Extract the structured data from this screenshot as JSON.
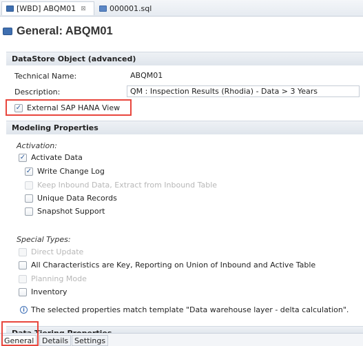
{
  "tabs": [
    {
      "label": "[WBD] ABQM01",
      "close": "⊠",
      "icon": "datastore-icon"
    },
    {
      "label": "000001.sql",
      "icon": "sql-file-icon"
    }
  ],
  "header": {
    "title": "General: ABQM01",
    "icon": "datastore-icon"
  },
  "dso_section": {
    "title": "DataStore Object (advanced)",
    "technical_name_label": "Technical Name:",
    "technical_name_value": "ABQM01",
    "description_label": "Description:",
    "description_value": "QM : Inspection Results (Rhodia) - Data > 3 Years",
    "external_view_label": "External SAP HANA View",
    "external_view_checked": true
  },
  "modeling": {
    "title": "Modeling Properties",
    "activation_label": "Activation:",
    "activate_data": {
      "label": "Activate Data",
      "checked": true
    },
    "write_change_log": {
      "label": "Write Change Log",
      "checked": true
    },
    "keep_inbound": {
      "label": "Keep Inbound Data, Extract from Inbound Table",
      "checked": false,
      "disabled": true
    },
    "unique_records": {
      "label": "Unique Data Records",
      "checked": false
    },
    "snapshot_support": {
      "label": "Snapshot Support",
      "checked": false
    },
    "special_types_label": "Special Types:",
    "direct_update": {
      "label": "Direct Update",
      "checked": false,
      "disabled": true
    },
    "all_chars_key": {
      "label": "All Characteristics are Key, Reporting on Union of Inbound and Active Table",
      "checked": false
    },
    "planning_mode": {
      "label": "Planning Mode",
      "checked": false,
      "disabled": true
    },
    "inventory": {
      "label": "Inventory",
      "checked": false
    },
    "info_message": "The selected properties match template \"Data warehouse layer - delta calculation\"."
  },
  "next_section": {
    "title": "Data Tiering Properties"
  },
  "bottom_tabs": [
    "General",
    "Details",
    "Settings"
  ],
  "colors": {
    "highlight": "#e8453c",
    "accent": "#3f6fb0"
  }
}
